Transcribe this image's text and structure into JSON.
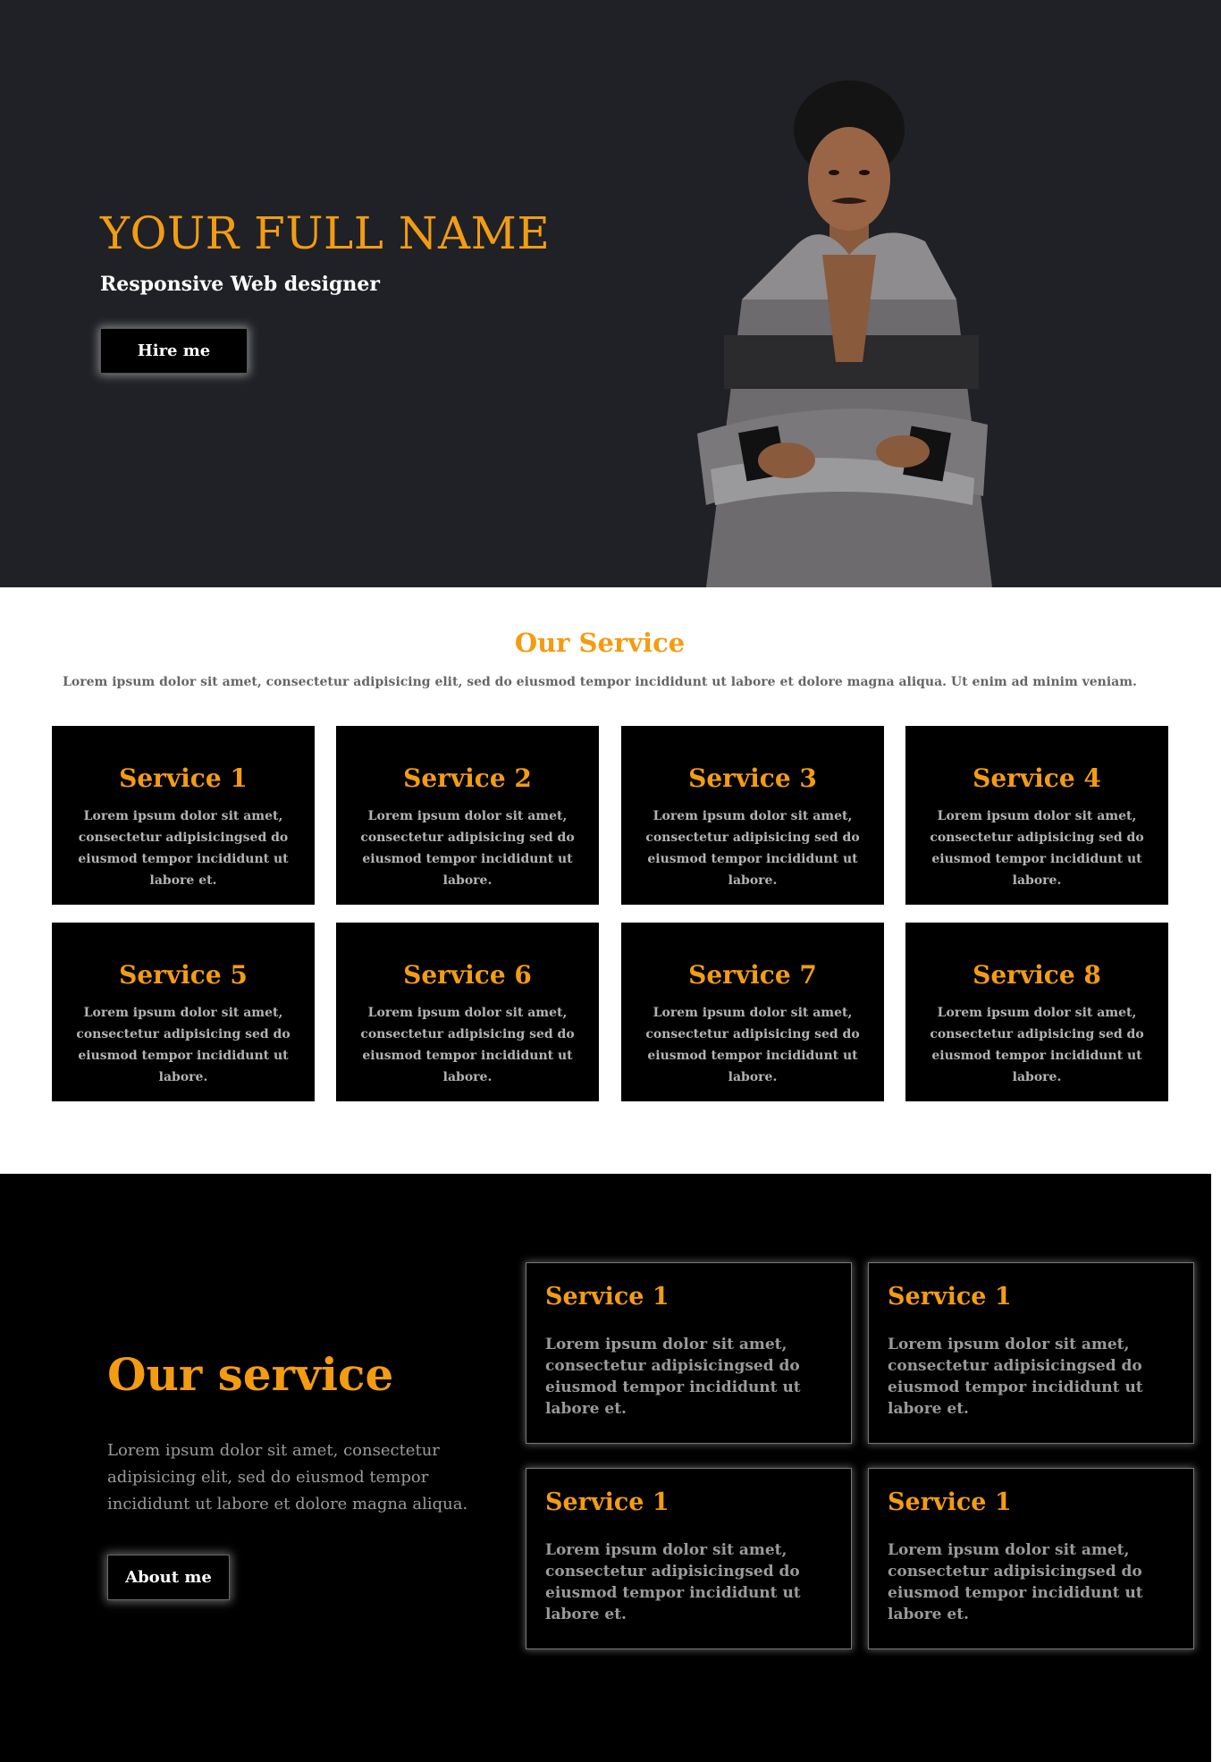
{
  "hero": {
    "name": "YOUR FULL NAME",
    "role": "Responsive Web designer",
    "hire_label": "Hire me"
  },
  "services": {
    "heading": "Our Service",
    "subtitle": "Lorem ipsum dolor sit amet, consectetur adipisicing elit, sed do eiusmod tempor incididunt ut labore et dolore magna aliqua. Ut enim ad minim veniam.",
    "cards": [
      {
        "title": "Service 1",
        "text": "Lorem ipsum dolor sit amet, consectetur adipisicingsed do eiusmod tempor incididunt ut labore et."
      },
      {
        "title": "Service 2",
        "text": "Lorem ipsum dolor sit amet, consectetur adipisicing sed do eiusmod tempor incididunt ut labore."
      },
      {
        "title": "Service 3",
        "text": "Lorem ipsum dolor sit amet, consectetur adipisicing sed do eiusmod tempor incididunt ut labore."
      },
      {
        "title": "Service 4",
        "text": "Lorem ipsum dolor sit amet, consectetur adipisicing sed do eiusmod tempor incididunt ut labore."
      },
      {
        "title": "Service 5",
        "text": "Lorem ipsum dolor sit amet, consectetur adipisicing sed do eiusmod tempor incididunt ut labore."
      },
      {
        "title": "Service 6",
        "text": "Lorem ipsum dolor sit amet, consectetur adipisicing sed do eiusmod tempor incididunt ut labore."
      },
      {
        "title": "Service 7",
        "text": "Lorem ipsum dolor sit amet, consectetur adipisicing sed do eiusmod tempor incididunt ut labore."
      },
      {
        "title": "Service 8",
        "text": "Lorem ipsum dolor sit amet, consectetur adipisicing sed do eiusmod tempor incididunt ut labore."
      }
    ]
  },
  "dark_service": {
    "title": "Our service",
    "text": "Lorem ipsum dolor sit amet, consectetur adipisicing elit, sed do eiusmod tempor incididunt ut labore et dolore magna aliqua.",
    "about_label": "About me",
    "cards": [
      {
        "title": "Service 1",
        "text": "Lorem ipsum dolor sit amet, consectetur adipisicingsed do eiusmod tempor incididunt ut labore et."
      },
      {
        "title": "Service 1",
        "text": "Lorem ipsum dolor sit amet, consectetur adipisicingsed do eiusmod tempor incididunt ut labore et."
      },
      {
        "title": "Service 1",
        "text": "Lorem ipsum dolor sit amet, consectetur adipisicingsed do eiusmod tempor incididunt ut labore et."
      },
      {
        "title": "Service 1",
        "text": "Lorem ipsum dolor sit amet, consectetur adipisicingsed do eiusmod tempor incididunt ut labore et."
      }
    ]
  },
  "colors": {
    "accent": "#f39c12",
    "hero_bg": "#1f2126",
    "card_bg": "#000000"
  }
}
